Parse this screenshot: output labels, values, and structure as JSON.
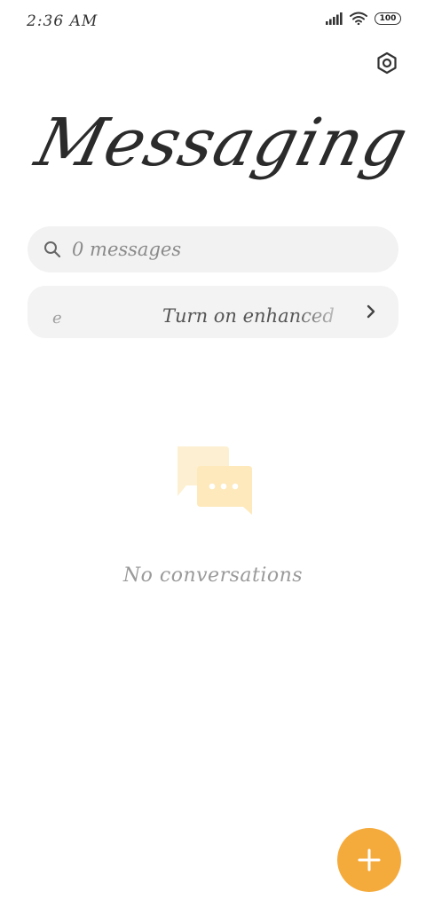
{
  "status_bar": {
    "time": "2:36 AM",
    "battery": "100",
    "icons": [
      "signal-icon",
      "wifi-icon",
      "battery-icon"
    ]
  },
  "header": {
    "title": "Messaging",
    "settings_icon": "settings-icon"
  },
  "search": {
    "placeholder": "0 messages",
    "icon": "search-icon"
  },
  "banner": {
    "lead": "e",
    "text": "Turn on enhanced",
    "chevron_icon": "chevron-right-icon"
  },
  "empty_state": {
    "icon": "chat-bubbles-icon",
    "text": "No conversations"
  },
  "fab": {
    "icon": "plus-icon"
  },
  "colors": {
    "accent": "#f5ab3c",
    "empty_icon": "#fde9bb",
    "surface": "#f2f2f2",
    "title": "#2b2b2b"
  }
}
